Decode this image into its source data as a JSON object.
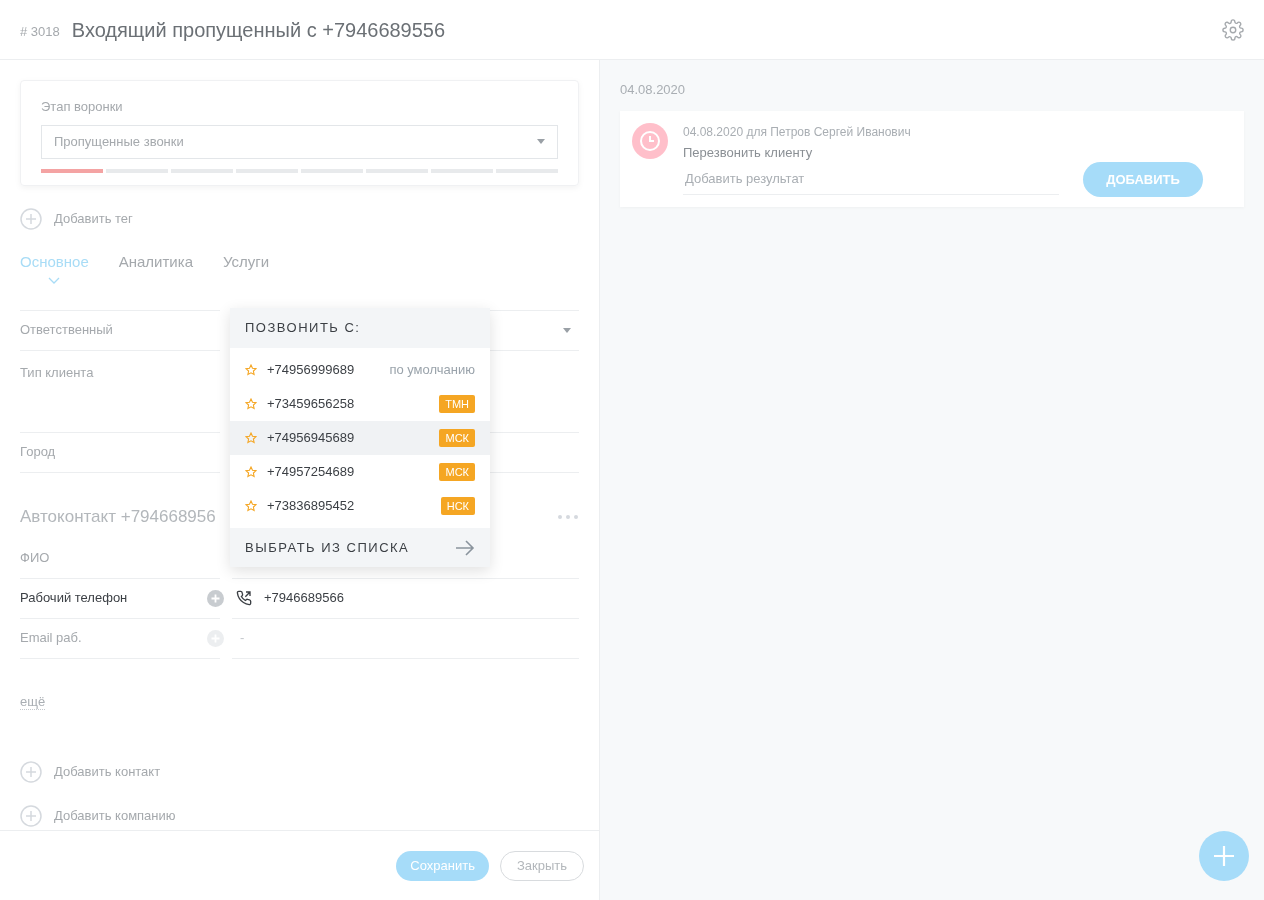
{
  "header": {
    "number": "# 3018",
    "title": "Входящий пропущенный с +7946689556"
  },
  "funnel": {
    "label": "Этап воронки",
    "value": "Пропущенные звонки",
    "stages": [
      {
        "selected": true
      },
      {
        "selected": false
      },
      {
        "selected": false
      },
      {
        "selected": false
      },
      {
        "selected": false
      },
      {
        "selected": false
      },
      {
        "selected": false
      },
      {
        "selected": false
      }
    ]
  },
  "add_tag": "Добавить тег",
  "tabs": [
    {
      "label": "Основное",
      "selected": true
    },
    {
      "label": "Аналитика",
      "selected": false
    },
    {
      "label": "Услуги",
      "selected": false
    }
  ],
  "fields": [
    {
      "label": "Ответственный",
      "kind": "select"
    },
    {
      "label": "Тип клиента",
      "kind": "tall"
    },
    {
      "label": "Город",
      "kind": "plain"
    }
  ],
  "contact": {
    "title": "Автоконтакт +794668956",
    "fields": [
      {
        "label": "ФИО",
        "kind": "plain"
      },
      {
        "label": "Рабочий телефон",
        "kind": "phone",
        "value": "+7946689566",
        "disabled": false
      },
      {
        "label": "Email раб.",
        "kind": "email",
        "value": "-",
        "disabled": true
      }
    ],
    "more": "ещё"
  },
  "add_contact": "Добавить контакт",
  "add_company": "Добавить компанию",
  "footer": {
    "save": "Сохранить",
    "close": "Закрыть"
  },
  "call_menu": {
    "title": "ПОЗВОНИТЬ С:",
    "items": [
      {
        "number": "+74956999689",
        "kind": "default",
        "tag": "по умолчанию",
        "highlighted": false
      },
      {
        "number": "+73459656258",
        "kind": "region",
        "tag": "ТМН",
        "highlighted": false
      },
      {
        "number": "+74956945689",
        "kind": "region",
        "tag": "МСК",
        "highlighted": true
      },
      {
        "number": "+74957254689",
        "kind": "region",
        "tag": "МСК",
        "highlighted": false
      },
      {
        "number": "+73836895452",
        "kind": "region",
        "tag": "НСК",
        "highlighted": false
      }
    ],
    "footer": "ВЫБРАТЬ ИЗ СПИСКА"
  },
  "timeline": {
    "date": "04.08.2020",
    "task": {
      "meta": "04.08.2020 для Петров Сергей Иванович",
      "text": "Перезвонить клиенту",
      "placeholder": "Добавить результат",
      "button": "ДОБАВИТЬ"
    }
  }
}
